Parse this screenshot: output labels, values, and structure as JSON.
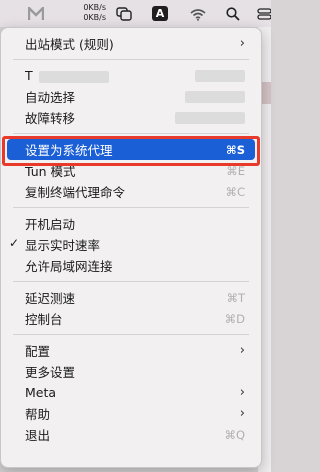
{
  "menubar": {
    "upload_speed": "0KB/s",
    "download_speed": "0KB/s",
    "input_badge": "A",
    "icons": [
      "app-logo-icon",
      "window-icon",
      "input-source-icon",
      "wifi-icon",
      "search-icon",
      "control-center-icon"
    ]
  },
  "menu": {
    "outbound_mode": "出站模式 (规则)",
    "proxy_group_1": "T",
    "auto_select": "自动选择",
    "failover": "故障转移",
    "set_system_proxy": "设置为系统代理",
    "set_system_proxy_sc": "⌘S",
    "tun_mode": "Tun 模式",
    "tun_mode_sc": "⌘E",
    "copy_terminal_cmd": "复制终端代理命令",
    "copy_terminal_cmd_sc": "⌘C",
    "launch_at_login": "开机启动",
    "show_speed": "显示实时速率",
    "allow_lan": "允许局域网连接",
    "latency_test": "延迟测速",
    "latency_test_sc": "⌘T",
    "dashboard": "控制台",
    "dashboard_sc": "⌘D",
    "config": "配置",
    "more_settings": "更多设置",
    "meta": "Meta",
    "help": "帮助",
    "quit": "退出",
    "quit_sc": "⌘Q",
    "submenu_arrow": "›",
    "checkmark": "✓"
  },
  "colors": {
    "highlight": "#1a5fd6",
    "annotation_box": "#e8392a"
  }
}
